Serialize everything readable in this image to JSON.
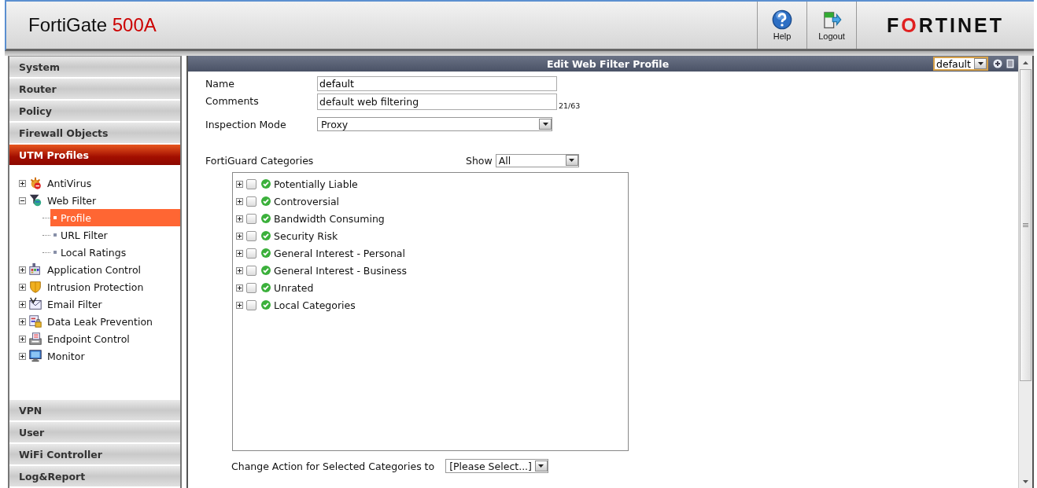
{
  "header": {
    "product": "FortiGate",
    "model": "500A",
    "tools": [
      {
        "kind": "help",
        "label": "Help"
      },
      {
        "kind": "logout",
        "label": "Logout"
      }
    ],
    "logo": "FORTINET"
  },
  "sidebar": {
    "sections": [
      {
        "label": "System",
        "selected": false
      },
      {
        "label": "Router",
        "selected": false
      },
      {
        "label": "Policy",
        "selected": false
      },
      {
        "label": "Firewall Objects",
        "selected": false
      },
      {
        "label": "UTM Profiles",
        "selected": true,
        "tree": [
          {
            "label": "AntiVirus",
            "kind": "antivirus",
            "expanded": false
          },
          {
            "label": "Web Filter",
            "kind": "webfilter",
            "expanded": true,
            "children": [
              {
                "label": "Profile",
                "selected": true
              },
              {
                "label": "URL Filter",
                "selected": false
              },
              {
                "label": "Local Ratings",
                "selected": false
              }
            ]
          },
          {
            "label": "Application Control",
            "kind": "appcontrol",
            "expanded": false
          },
          {
            "label": "Intrusion Protection",
            "kind": "ips",
            "expanded": false
          },
          {
            "label": "Email Filter",
            "kind": "email",
            "expanded": false
          },
          {
            "label": "Data Leak Prevention",
            "kind": "dlp",
            "expanded": false
          },
          {
            "label": "Endpoint Control",
            "kind": "endpoint",
            "expanded": false
          },
          {
            "label": "Monitor",
            "kind": "monitor",
            "expanded": false
          }
        ]
      },
      {
        "label": "VPN",
        "selected": false
      },
      {
        "label": "User",
        "selected": false
      },
      {
        "label": "WiFi Controller",
        "selected": false
      },
      {
        "label": "Log&Report",
        "selected": false
      }
    ]
  },
  "panel": {
    "title": "Edit Web Filter Profile",
    "profile_select": "default",
    "name": {
      "label": "Name",
      "value": "default"
    },
    "comments": {
      "label": "Comments",
      "value": "default web filtering",
      "counter": "21/63"
    },
    "inspection_mode": {
      "label": "Inspection Mode",
      "value": "Proxy"
    },
    "categories_label": "FortiGuard Categories",
    "show_label": "Show",
    "show_value": "All",
    "categories": [
      {
        "label": "Potentially Liable",
        "checked": false
      },
      {
        "label": "Controversial",
        "checked": false
      },
      {
        "label": "Bandwidth Consuming",
        "checked": false
      },
      {
        "label": "Security Risk",
        "checked": false
      },
      {
        "label": "General Interest - Personal",
        "checked": false
      },
      {
        "label": "General Interest - Business",
        "checked": false
      },
      {
        "label": "Unrated",
        "checked": false
      },
      {
        "label": "Local Categories",
        "checked": false
      }
    ],
    "change_action_label": "Change Action for Selected Categories to",
    "change_action_value": "[Please Select...]"
  }
}
